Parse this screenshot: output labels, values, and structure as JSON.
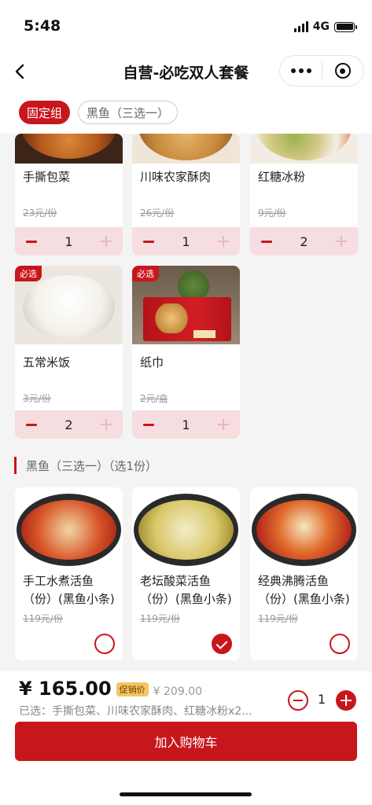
{
  "status_bar": {
    "time": "5:48",
    "network": "4G"
  },
  "nav": {
    "title": "自营-必吃双人套餐"
  },
  "tabs": [
    {
      "label": "固定组",
      "active": true
    },
    {
      "label": "黑鱼（三选一）",
      "active": false
    }
  ],
  "fixed_items": [
    {
      "name": "手撕包菜",
      "price": "23元/份",
      "qty": "1"
    },
    {
      "name": "川味农家酥肉",
      "price": "26元/份",
      "qty": "1"
    },
    {
      "name": "红糖冰粉",
      "price": "9元/份",
      "qty": "2"
    },
    {
      "name": "五常米饭",
      "price": "3元/份",
      "qty": "2",
      "badge": "必选"
    },
    {
      "name": "纸巾",
      "price": "2元/盒",
      "qty": "1",
      "badge": "必选"
    }
  ],
  "fish_section": {
    "title": "黑鱼（三选一）（选1份）"
  },
  "fish_items": [
    {
      "name": "手工水煮活鱼（份）(黑鱼小条)",
      "price": "119元/份",
      "selected": false
    },
    {
      "name": "老坛酸菜活鱼（份）(黑鱼小条)",
      "price": "119元/份",
      "selected": true
    },
    {
      "name": "经典沸腾活鱼（份）(黑鱼小条)",
      "price": "119元/份",
      "selected": false
    }
  ],
  "bottom": {
    "price": "¥ 165.00",
    "promo_label": "促销价",
    "original_price": "¥ 209.00",
    "selected_summary": "已选：手撕包菜、川味农家酥肉、红糖冰粉x2...",
    "quantity": "1",
    "add_to_cart": "加入购物车"
  },
  "colors": {
    "accent": "#c8161d",
    "stepper_bg": "#f6dde0",
    "promo": "#f3c660"
  }
}
